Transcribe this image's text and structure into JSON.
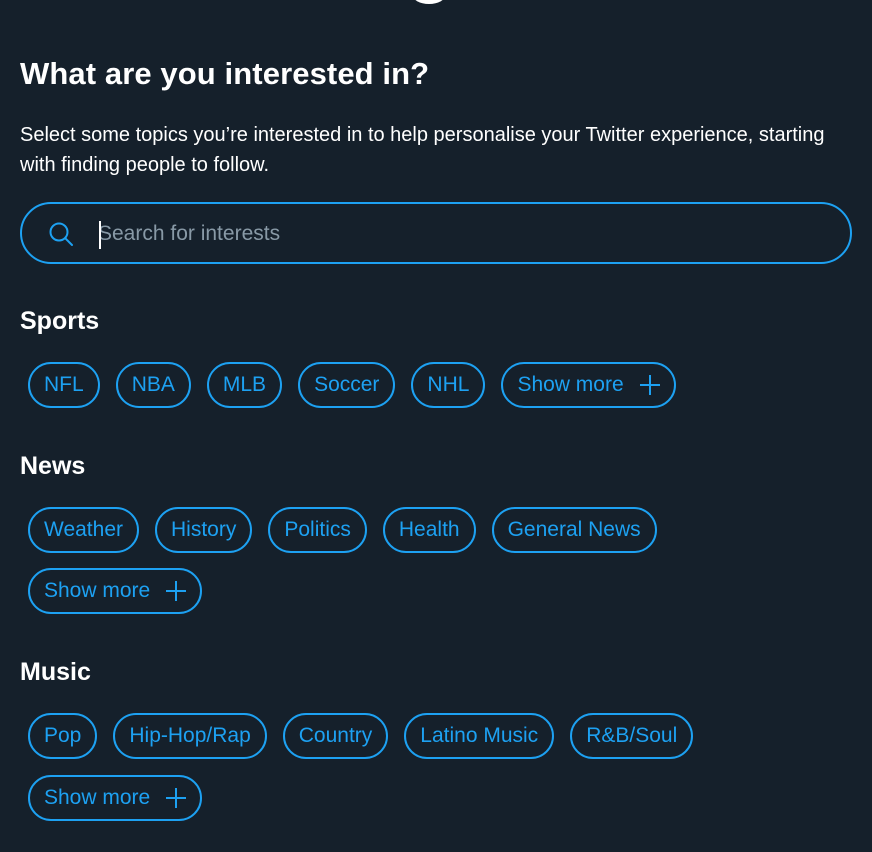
{
  "header": {
    "title": "What are you interested in?",
    "subtitle": "Select some topics you’re interested in to help personalise your Twitter experience, starting with finding people to follow."
  },
  "search": {
    "placeholder": "Search for interests",
    "icon": "search-icon"
  },
  "colors": {
    "background": "#15202b",
    "accent": "#1da1f2",
    "text": "#ffffff",
    "placeholder": "#8899a6"
  },
  "sections": [
    {
      "title": "Sports",
      "topics": [
        "NFL",
        "NBA",
        "MLB",
        "Soccer",
        "NHL"
      ],
      "show_more": "Show more"
    },
    {
      "title": "News",
      "topics": [
        "Weather",
        "History",
        "Politics",
        "Health",
        "General News"
      ],
      "show_more": "Show more"
    },
    {
      "title": "Music",
      "topics": [
        "Pop",
        "Hip-Hop/Rap",
        "Country",
        "Latino Music",
        "R&B/Soul"
      ],
      "show_more": "Show more"
    }
  ]
}
